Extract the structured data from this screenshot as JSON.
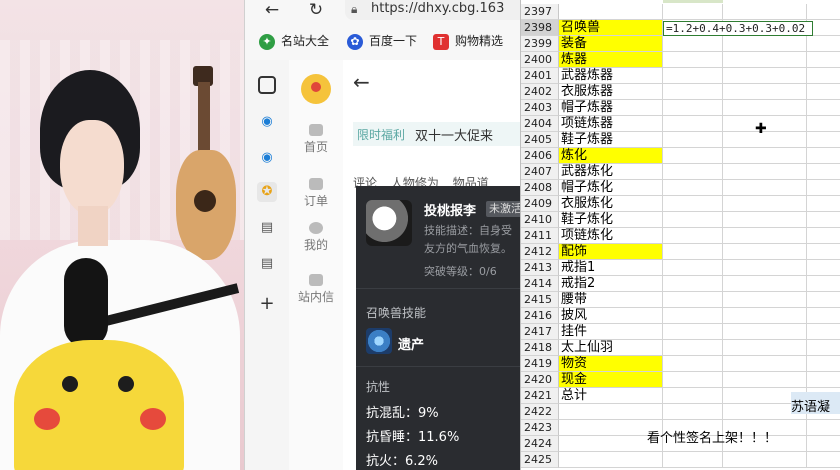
{
  "browser": {
    "url": "https://dhxy.cbg.163",
    "bookmarks": [
      {
        "label": "名站大全",
        "color": "#2f9e44",
        "icon": "globe-icon"
      },
      {
        "label": "百度一下",
        "color": "#2a5bd7",
        "icon": "paw-icon"
      },
      {
        "label": "购物精选",
        "color": "#e03131",
        "icon": "t-icon"
      }
    ]
  },
  "app_nav": {
    "items": [
      {
        "label": "首页"
      },
      {
        "label": "订单"
      },
      {
        "label": "我的"
      },
      {
        "label": "站内信"
      }
    ]
  },
  "page": {
    "promo_tag": "限时福利",
    "promo_text": "双十一大促来",
    "tabs": [
      "评论",
      "人物修为",
      "物品道"
    ]
  },
  "tooltip": {
    "pet_name": "投桃报李",
    "pet_badge": "未激活",
    "desc_line1": "技能描述：自身受",
    "desc_line2": "友方的气血恢复。",
    "break_level": "突破等级：0/6",
    "skill_section": "召唤兽技能",
    "skill_name": "遗产",
    "resist_section": "抗性",
    "resists": [
      "抗混乱：9%",
      "抗昏睡：11.6%",
      "抗火：6.2%"
    ]
  },
  "sheet": {
    "formula": "=1.2+0.4+0.3+0.3+0.02",
    "blue_text": "苏语凝",
    "banner": "看个性签名上架！！！",
    "rows": [
      {
        "n": "2397",
        "a": "",
        "yellow": false
      },
      {
        "n": "2398",
        "a": "召唤兽",
        "yellow": true
      },
      {
        "n": "2399",
        "a": "装备",
        "yellow": true
      },
      {
        "n": "2400",
        "a": "炼器",
        "yellow": true
      },
      {
        "n": "2401",
        "a": "武器炼器",
        "yellow": false
      },
      {
        "n": "2402",
        "a": "衣服炼器",
        "yellow": false
      },
      {
        "n": "2403",
        "a": "帽子炼器",
        "yellow": false
      },
      {
        "n": "2404",
        "a": "项链炼器",
        "yellow": false
      },
      {
        "n": "2405",
        "a": "鞋子炼器",
        "yellow": false
      },
      {
        "n": "2406",
        "a": "炼化",
        "yellow": true
      },
      {
        "n": "2407",
        "a": "武器炼化",
        "yellow": false
      },
      {
        "n": "2408",
        "a": "帽子炼化",
        "yellow": false
      },
      {
        "n": "2409",
        "a": "衣服炼化",
        "yellow": false
      },
      {
        "n": "2410",
        "a": "鞋子炼化",
        "yellow": false
      },
      {
        "n": "2411",
        "a": "项链炼化",
        "yellow": false
      },
      {
        "n": "2412",
        "a": "配饰",
        "yellow": true
      },
      {
        "n": "2413",
        "a": "戒指1",
        "yellow": false
      },
      {
        "n": "2414",
        "a": "戒指2",
        "yellow": false
      },
      {
        "n": "2415",
        "a": "腰带",
        "yellow": false
      },
      {
        "n": "2416",
        "a": "披风",
        "yellow": false
      },
      {
        "n": "2417",
        "a": "挂件",
        "yellow": false
      },
      {
        "n": "2418",
        "a": "太上仙羽",
        "yellow": false
      },
      {
        "n": "2419",
        "a": "物资",
        "yellow": true
      },
      {
        "n": "2420",
        "a": "现金",
        "yellow": true
      },
      {
        "n": "2421",
        "a": "总计",
        "yellow": false
      },
      {
        "n": "2422",
        "a": "",
        "yellow": false
      },
      {
        "n": "2423",
        "a": "",
        "yellow": false
      },
      {
        "n": "2424",
        "a": "",
        "yellow": false
      },
      {
        "n": "2425",
        "a": "",
        "yellow": false
      }
    ]
  }
}
